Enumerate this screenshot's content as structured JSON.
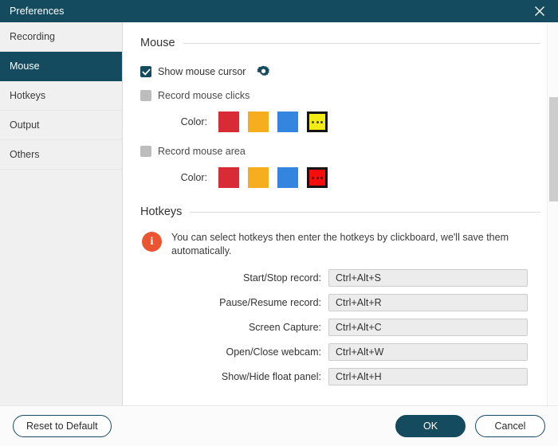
{
  "window": {
    "title": "Preferences",
    "close_icon": "close-icon",
    "accent": "#154B5E"
  },
  "sidebar": {
    "items": [
      {
        "label": "Recording",
        "active": false
      },
      {
        "label": "Mouse",
        "active": true
      },
      {
        "label": "Hotkeys",
        "active": false
      },
      {
        "label": "Output",
        "active": false
      },
      {
        "label": "Others",
        "active": false
      }
    ]
  },
  "mouse": {
    "section_title": "Mouse",
    "show_cursor": {
      "label": "Show mouse cursor",
      "checked": true,
      "settings_icon": "gear-icon"
    },
    "record_clicks": {
      "label": "Record mouse clicks",
      "checked": false,
      "color_label": "Color:",
      "colors": [
        "#D92B35",
        "#F7AE1E",
        "#3485E0",
        "#F2EC14"
      ],
      "selected_index": 3
    },
    "record_area": {
      "label": "Record mouse area",
      "checked": false,
      "color_label": "Color:",
      "colors": [
        "#D92B35",
        "#F7AE1E",
        "#3485E0",
        "#F80D0D"
      ],
      "selected_index": 3
    }
  },
  "hotkeys": {
    "section_title": "Hotkeys",
    "info_icon": "info-icon",
    "info_color": "#EA5430",
    "info_text": "You can select hotkeys then enter the hotkeys by clickboard, we'll save them automatically.",
    "rows": [
      {
        "label": "Start/Stop record:",
        "value": "Ctrl+Alt+S"
      },
      {
        "label": "Pause/Resume record:",
        "value": "Ctrl+Alt+R"
      },
      {
        "label": "Screen Capture:",
        "value": "Ctrl+Alt+C"
      },
      {
        "label": "Open/Close webcam:",
        "value": "Ctrl+Alt+W"
      },
      {
        "label": "Show/Hide float panel:",
        "value": "Ctrl+Alt+H"
      }
    ]
  },
  "footer": {
    "reset_label": "Reset to Default",
    "ok_label": "OK",
    "cancel_label": "Cancel"
  }
}
